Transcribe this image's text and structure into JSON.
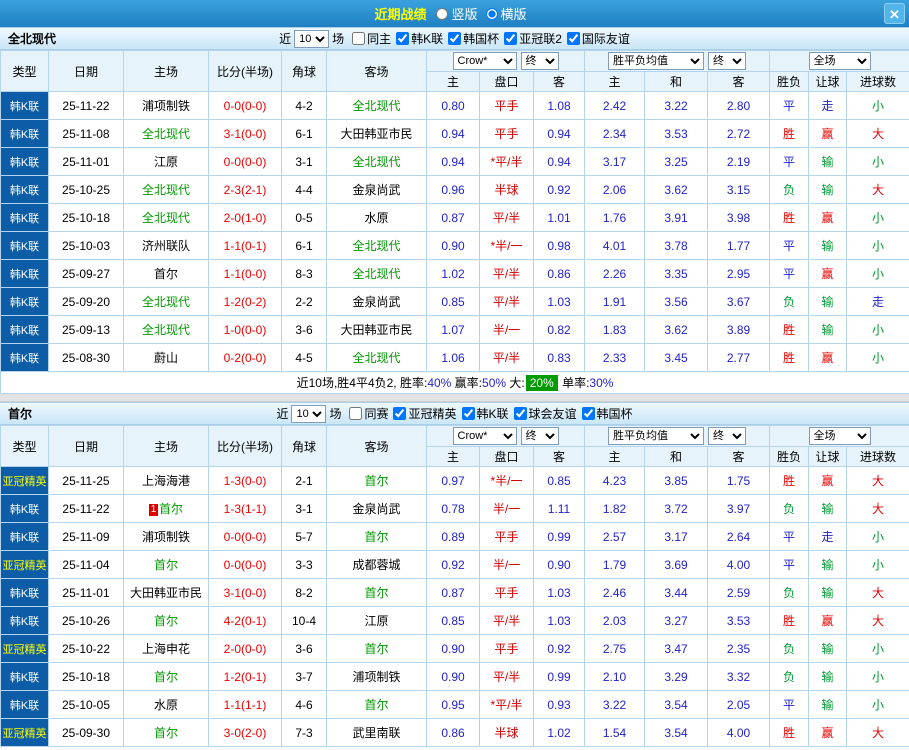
{
  "topbar": {
    "title": "近期战绩",
    "layout_options": [
      {
        "label": "竖版",
        "selected": false
      },
      {
        "label": "横版",
        "selected": true
      }
    ],
    "close_icon": "✕"
  },
  "colors": {
    "accent_blue": "#1e7fc1",
    "type_cell_bg": "#0d5ca8",
    "odds_blue": "#2222cc",
    "score_red": "#ee0000",
    "focus_green": "#009900",
    "badge_green": "#009b00"
  },
  "filter_labels": {
    "prefix": "近",
    "suffix": "场"
  },
  "headers": {
    "type": "类型",
    "date": "日期",
    "home": "主场",
    "score": "比分(半场)",
    "corner": "角球",
    "away": "客场",
    "asia_sub": [
      "主",
      "盘口",
      "客"
    ],
    "europe_sub": [
      "主",
      "和",
      "客"
    ],
    "result_sub": [
      "胜负",
      "让球",
      "进球数"
    ],
    "dropdown_company": "Crow*",
    "dropdown_asia_final": "终",
    "dropdown_avg": "胜平负均值",
    "dropdown_europe_final": "终",
    "dropdown_scope": "全场"
  },
  "type_colors": {
    "韩K联": "#ffffff",
    "亚冠精英": "#ffff00"
  },
  "result_colors": {
    "胜": "#ee0000",
    "赢": "#ee0000",
    "大": "#ee0000",
    "负": "#009933",
    "输": "#009933",
    "小": "#009933",
    "平": "#2222cc",
    "走": "#2222cc"
  },
  "sections": [
    {
      "team": "全北现代",
      "filter_count": "10",
      "checkboxes": [
        {
          "label": "同主",
          "checked": false
        },
        {
          "label": "韩K联",
          "checked": true
        },
        {
          "label": "韩国杯",
          "checked": true
        },
        {
          "label": "亚冠联2",
          "checked": true
        },
        {
          "label": "国际友谊",
          "checked": true
        }
      ],
      "rows": [
        {
          "type": "韩K联",
          "date": "25-11-22",
          "home": "浦项制铁",
          "score": "0-0(0-0)",
          "corner": "4-2",
          "away": "全北现代",
          "asia": [
            "0.80",
            "平手",
            "1.08"
          ],
          "europe": [
            "2.42",
            "3.22",
            "2.80"
          ],
          "results": [
            "平",
            "走",
            "小"
          ]
        },
        {
          "type": "韩K联",
          "date": "25-11-08",
          "home": "全北现代",
          "score": "3-1(0-0)",
          "corner": "6-1",
          "away": "大田韩亚市民",
          "asia": [
            "0.94",
            "平手",
            "0.94"
          ],
          "europe": [
            "2.34",
            "3.53",
            "2.72"
          ],
          "results": [
            "胜",
            "赢",
            "大"
          ]
        },
        {
          "type": "韩K联",
          "date": "25-11-01",
          "home": "江原",
          "score": "0-0(0-0)",
          "corner": "3-1",
          "away": "全北现代",
          "asia": [
            "0.94",
            "*平/半",
            "0.94"
          ],
          "europe": [
            "3.17",
            "3.25",
            "2.19"
          ],
          "results": [
            "平",
            "输",
            "小"
          ]
        },
        {
          "type": "韩K联",
          "date": "25-10-25",
          "home": "全北现代",
          "score": "2-3(2-1)",
          "corner": "4-4",
          "away": "金泉尚武",
          "asia": [
            "0.96",
            "半球",
            "0.92"
          ],
          "europe": [
            "2.06",
            "3.62",
            "3.15"
          ],
          "results": [
            "负",
            "输",
            "大"
          ]
        },
        {
          "type": "韩K联",
          "date": "25-10-18",
          "home": "全北现代",
          "score": "2-0(1-0)",
          "corner": "0-5",
          "away": "水原",
          "asia": [
            "0.87",
            "平/半",
            "1.01"
          ],
          "europe": [
            "1.76",
            "3.91",
            "3.98"
          ],
          "results": [
            "胜",
            "赢",
            "小"
          ]
        },
        {
          "type": "韩K联",
          "date": "25-10-03",
          "home": "济州联队",
          "score": "1-1(0-1)",
          "corner": "6-1",
          "away": "全北现代",
          "asia": [
            "0.90",
            "*半/一",
            "0.98"
          ],
          "europe": [
            "4.01",
            "3.78",
            "1.77"
          ],
          "results": [
            "平",
            "输",
            "小"
          ]
        },
        {
          "type": "韩K联",
          "date": "25-09-27",
          "home": "首尔",
          "score": "1-1(0-0)",
          "corner": "8-3",
          "away": "全北现代",
          "asia": [
            "1.02",
            "平/半",
            "0.86"
          ],
          "europe": [
            "2.26",
            "3.35",
            "2.95"
          ],
          "results": [
            "平",
            "赢",
            "小"
          ]
        },
        {
          "type": "韩K联",
          "date": "25-09-20",
          "home": "全北现代",
          "score": "1-2(0-2)",
          "corner": "2-2",
          "away": "金泉尚武",
          "asia": [
            "0.85",
            "平/半",
            "1.03"
          ],
          "europe": [
            "1.91",
            "3.56",
            "3.67"
          ],
          "results": [
            "负",
            "输",
            "走"
          ]
        },
        {
          "type": "韩K联",
          "date": "25-09-13",
          "home": "全北现代",
          "score": "1-0(0-0)",
          "corner": "3-6",
          "away": "大田韩亚市民",
          "asia": [
            "1.07",
            "半/一",
            "0.82"
          ],
          "europe": [
            "1.83",
            "3.62",
            "3.89"
          ],
          "results": [
            "胜",
            "输",
            "小"
          ]
        },
        {
          "type": "韩K联",
          "date": "25-08-30",
          "home": "蔚山",
          "score": "0-2(0-0)",
          "corner": "4-5",
          "away": "全北现代",
          "asia": [
            "1.06",
            "平/半",
            "0.83"
          ],
          "europe": [
            "2.33",
            "3.45",
            "2.77"
          ],
          "results": [
            "胜",
            "赢",
            "小"
          ]
        }
      ],
      "summary": [
        {
          "text": "近10场,胜4平4负2, 胜率:"
        },
        {
          "text": "40%",
          "style": "blue"
        },
        {
          "text": " 赢率:"
        },
        {
          "text": "50%",
          "style": "blue"
        },
        {
          "text": " 大:"
        },
        {
          "text": "20%",
          "style": "badge"
        },
        {
          "text": " 单率:"
        },
        {
          "text": "30%",
          "style": "blue"
        }
      ]
    },
    {
      "team": "首尔",
      "filter_count": "10",
      "checkboxes": [
        {
          "label": "同赛",
          "checked": false
        },
        {
          "label": "亚冠精英",
          "checked": true
        },
        {
          "label": "韩K联",
          "checked": true
        },
        {
          "label": "球会友谊",
          "checked": true
        },
        {
          "label": "韩国杯",
          "checked": true
        }
      ],
      "rows": [
        {
          "type": "亚冠精英",
          "date": "25-11-25",
          "home": "上海海港",
          "score": "1-3(0-0)",
          "corner": "2-1",
          "away": "首尔",
          "asia": [
            "0.97",
            "*半/一",
            "0.85"
          ],
          "europe": [
            "4.23",
            "3.85",
            "1.75"
          ],
          "results": [
            "胜",
            "赢",
            "大"
          ]
        },
        {
          "type": "韩K联",
          "date": "25-11-22",
          "home": "首尔",
          "home_badge": "1",
          "score": "1-3(1-1)",
          "corner": "3-1",
          "away": "金泉尚武",
          "asia": [
            "0.78",
            "半/一",
            "1.11"
          ],
          "europe": [
            "1.82",
            "3.72",
            "3.97"
          ],
          "results": [
            "负",
            "输",
            "大"
          ]
        },
        {
          "type": "韩K联",
          "date": "25-11-09",
          "home": "浦项制铁",
          "score": "0-0(0-0)",
          "corner": "5-7",
          "away": "首尔",
          "asia": [
            "0.89",
            "平手",
            "0.99"
          ],
          "europe": [
            "2.57",
            "3.17",
            "2.64"
          ],
          "results": [
            "平",
            "走",
            "小"
          ]
        },
        {
          "type": "亚冠精英",
          "date": "25-11-04",
          "home": "首尔",
          "score": "0-0(0-0)",
          "corner": "3-3",
          "away": "成都蓉城",
          "asia": [
            "0.92",
            "半/一",
            "0.90"
          ],
          "europe": [
            "1.79",
            "3.69",
            "4.00"
          ],
          "results": [
            "平",
            "输",
            "小"
          ]
        },
        {
          "type": "韩K联",
          "date": "25-11-01",
          "home": "大田韩亚市民",
          "score": "3-1(0-0)",
          "corner": "8-2",
          "away": "首尔",
          "asia": [
            "0.87",
            "平手",
            "1.03"
          ],
          "europe": [
            "2.46",
            "3.44",
            "2.59"
          ],
          "results": [
            "负",
            "输",
            "大"
          ]
        },
        {
          "type": "韩K联",
          "date": "25-10-26",
          "home": "首尔",
          "score": "4-2(0-1)",
          "corner": "10-4",
          "away": "江原",
          "asia": [
            "0.85",
            "平/半",
            "1.03"
          ],
          "europe": [
            "2.03",
            "3.27",
            "3.53"
          ],
          "results": [
            "胜",
            "赢",
            "大"
          ]
        },
        {
          "type": "亚冠精英",
          "date": "25-10-22",
          "home": "上海申花",
          "score": "2-0(0-0)",
          "corner": "3-6",
          "away": "首尔",
          "asia": [
            "0.90",
            "平手",
            "0.92"
          ],
          "europe": [
            "2.75",
            "3.47",
            "2.35"
          ],
          "results": [
            "负",
            "输",
            "小"
          ]
        },
        {
          "type": "韩K联",
          "date": "25-10-18",
          "home": "首尔",
          "score": "1-2(0-1)",
          "corner": "3-7",
          "away": "浦项制铁",
          "asia": [
            "0.90",
            "平/半",
            "0.99"
          ],
          "europe": [
            "2.10",
            "3.29",
            "3.32"
          ],
          "results": [
            "负",
            "输",
            "小"
          ]
        },
        {
          "type": "韩K联",
          "date": "25-10-05",
          "home": "水原",
          "score": "1-1(1-1)",
          "corner": "4-6",
          "away": "首尔",
          "asia": [
            "0.95",
            "*平/半",
            "0.93"
          ],
          "europe": [
            "3.22",
            "3.54",
            "2.05"
          ],
          "results": [
            "平",
            "输",
            "小"
          ]
        },
        {
          "type": "亚冠精英",
          "date": "25-09-30",
          "home": "首尔",
          "score": "3-0(2-0)",
          "corner": "7-3",
          "away": "武里南联",
          "asia": [
            "0.86",
            "半球",
            "1.02"
          ],
          "europe": [
            "1.54",
            "3.54",
            "4.00"
          ],
          "results": [
            "胜",
            "赢",
            "大"
          ]
        }
      ],
      "summary": []
    }
  ]
}
